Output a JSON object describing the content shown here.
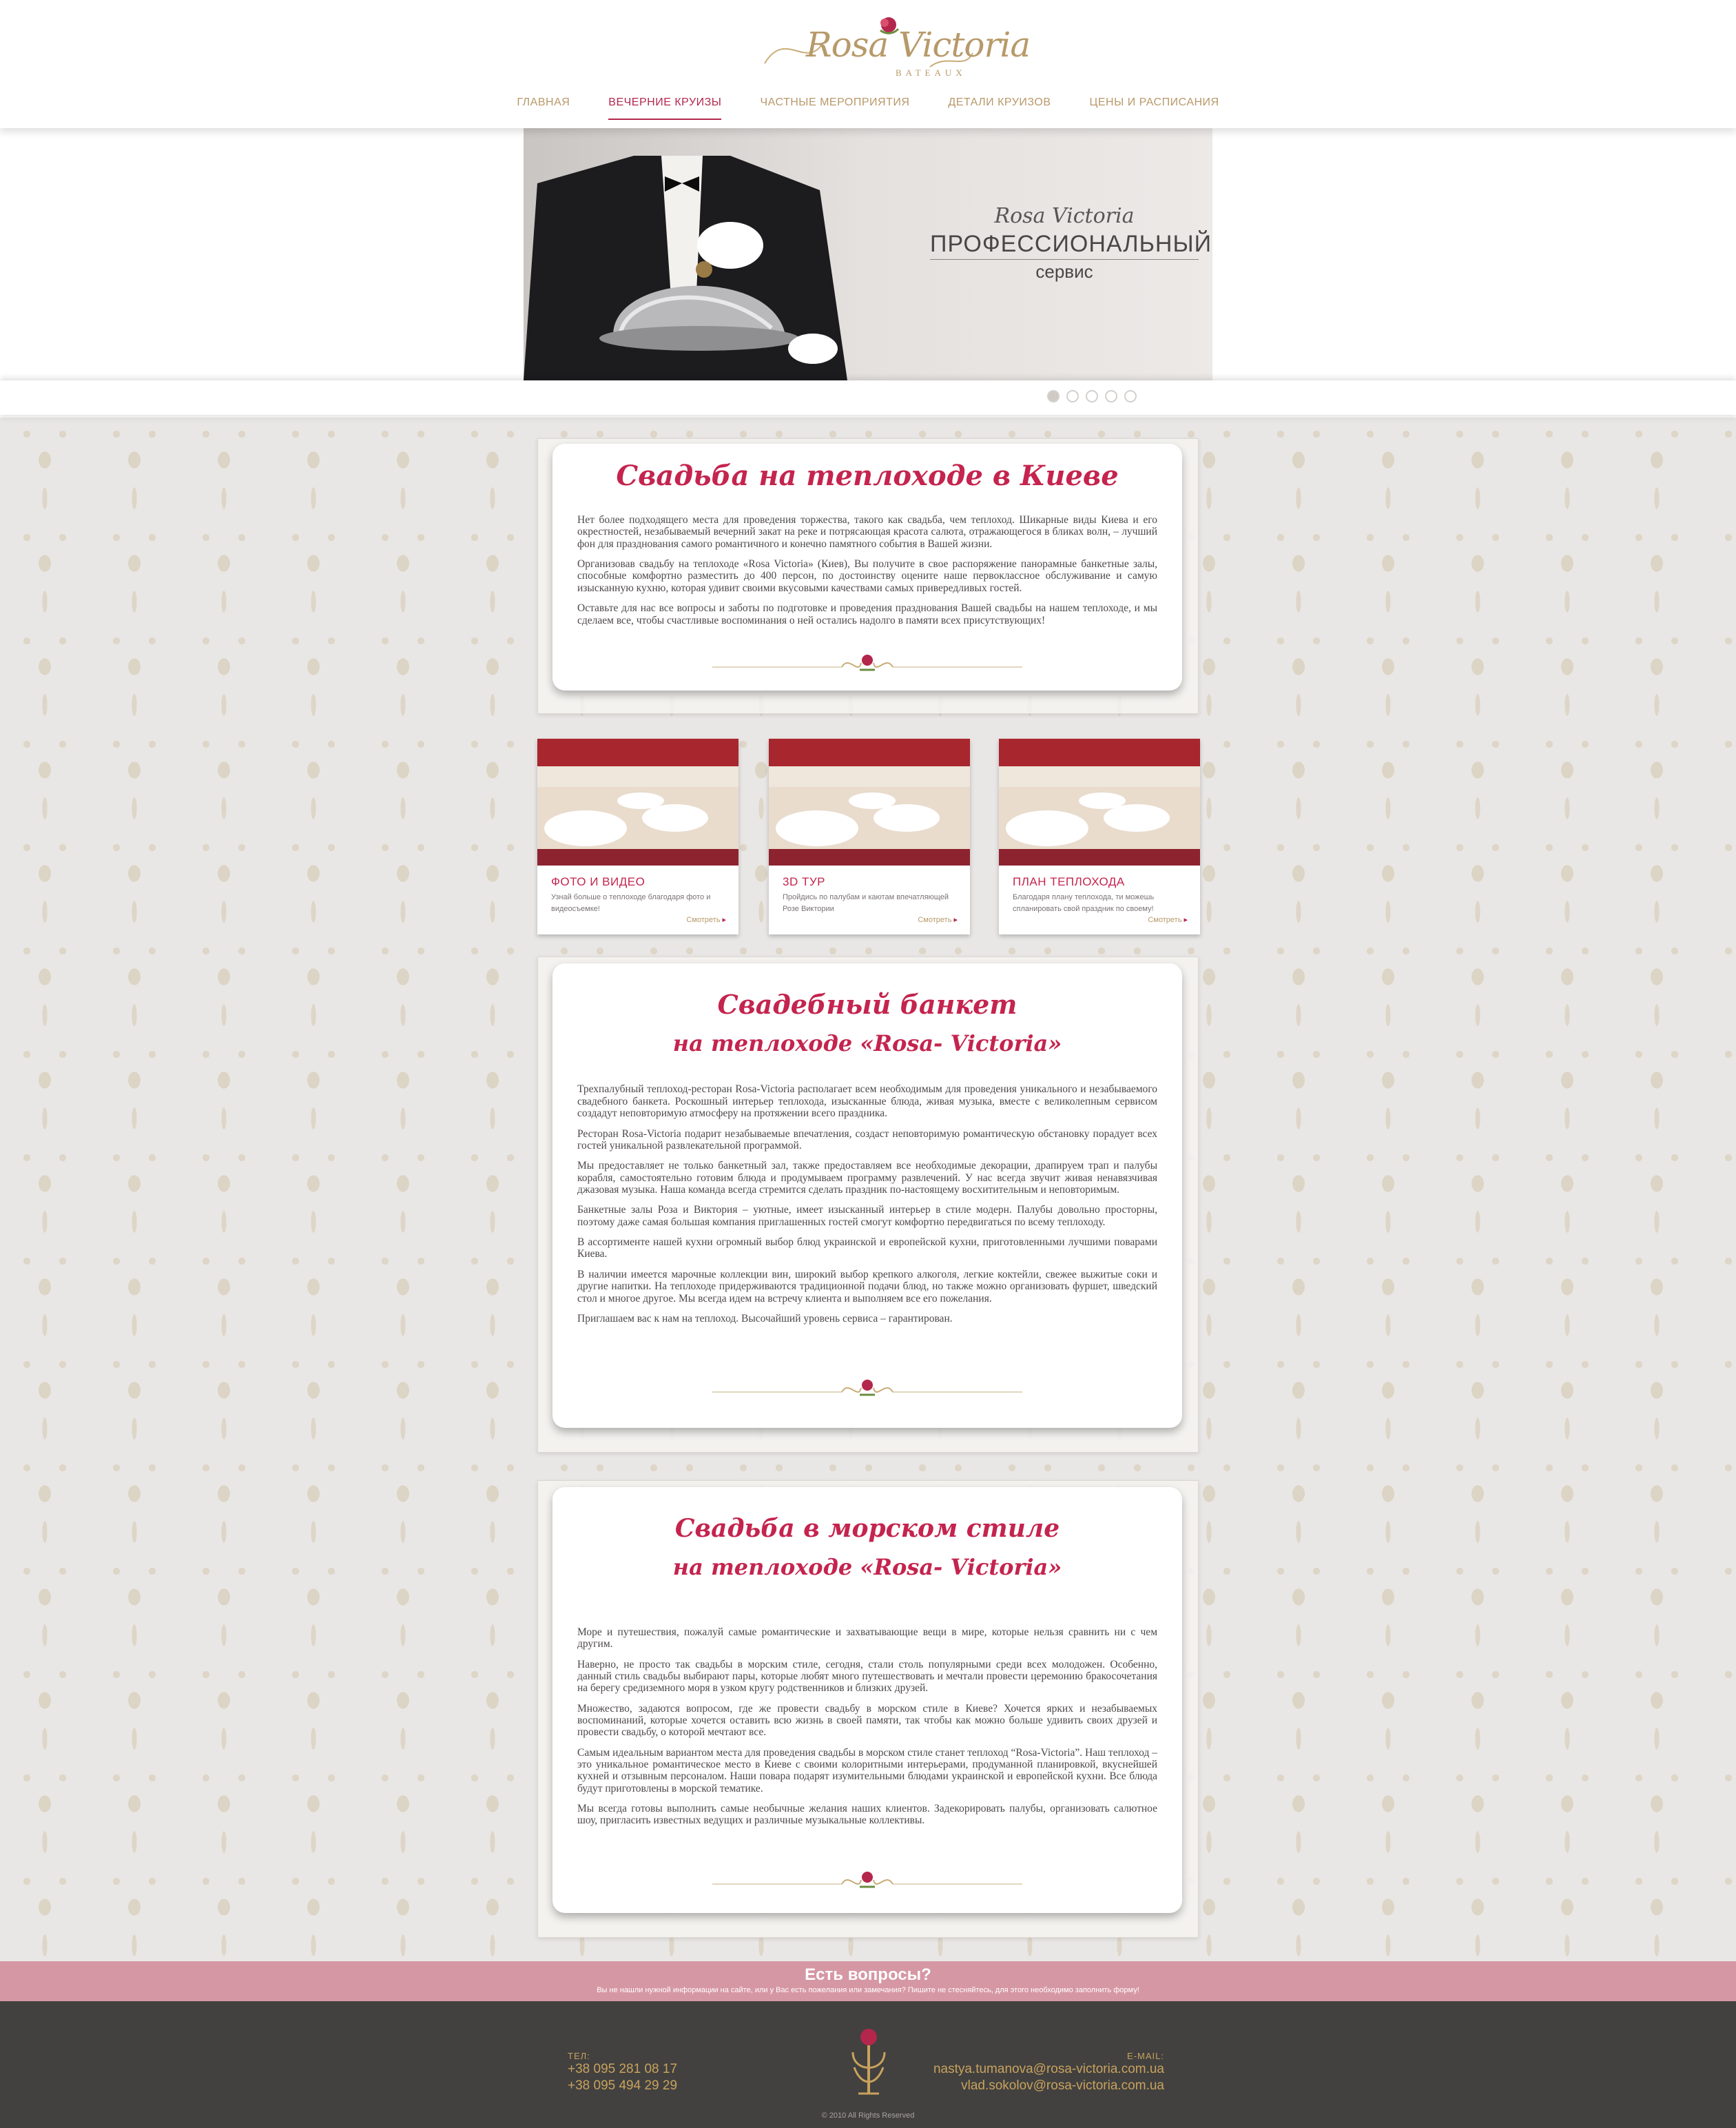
{
  "brand": {
    "logo_text": "Rosa Victoria",
    "logo_sub": "BATEAUX"
  },
  "nav": {
    "items": [
      {
        "label": "ГЛАВНАЯ",
        "active": false
      },
      {
        "label": "ВЕЧЕРНИЕ КРУИЗЫ",
        "active": true
      },
      {
        "label": "ЧАСТНЫЕ МЕРОПРИЯТИЯ",
        "active": false
      },
      {
        "label": "ДЕТАЛИ КРУИЗОВ",
        "active": false
      },
      {
        "label": "ЦЕНЫ И РАСПИСАНИЯ",
        "active": false
      }
    ]
  },
  "hero": {
    "brand": "Rosa Victoria",
    "title": "ПРОФЕССИОНАЛЬНЫЙ",
    "subtitle": "сервис",
    "slide_count": 5,
    "active_slide": 1
  },
  "section1": {
    "title": "Свадьба на теплоходе в Киеве",
    "paragraphs": [
      "Нет более подходящего места для проведения торжества, такого как свадьба, чем теплоход. Шикарные виды Киева и его окрестностей, незабываемый вечерний закат на реке и потрясающая красота салюта, отражающегося в бликах волн, – лучший фон для празднования самого романтичного и конечно памятного события в Вашей жизни.",
      "Организовав свадьбу на теплоходе «Rosa Victoria» (Киев), Вы получите в свое распоряжение панорамные банкетные залы, способные комфортно разместить до 400 персон, по достоинству оцените наше первоклассное обслуживание и самую изысканную кухню, которая удивит своими вкусовыми качествами самых привередливых гостей.",
      "Оставьте для нас все вопросы и заботы по подготовке и проведения празднования Вашей свадьбы на нашем теплоходе, и мы сделаем все, чтобы счастливые воспоминания о ней остались надолго в памяти всех присутствующих!"
    ]
  },
  "tiles": [
    {
      "title": "ФОТО И ВИДЕО",
      "text": "Узнай больше о теплоходе благодаря фото и видеосъемке!",
      "link": "Смотреть"
    },
    {
      "title": "3D ТУР",
      "text": "Пройдись по палубам и каютам впечатляющей Розе Виктории",
      "link": "Смотреть"
    },
    {
      "title": "ПЛАН ТЕПЛОХОДА",
      "text": "Благодаря плану теплохода, ти можешь спланировать свой праздник по своему!",
      "link": "Смотреть"
    }
  ],
  "section2": {
    "title_line1": "Свадебный банкет",
    "title_line2": "на теплоходе «Rosa- Victoria»",
    "paragraphs": [
      "Трехпалубный теплоход-ресторан Rosa-Victoria располагает всем необходимым для проведения уникального и незабываемого свадебного банкета. Роскошный интерьер теплохода, изысканные блюда, живая музыка, вместе с великолепным сервисом создадут неповторимую атмосферу на протяжении всего праздника.",
      "Ресторан Rosa-Victoria подарит незабываемые впечатления, создаст неповторимую романтическую обстановку порадует всех гостей уникальной развлекательной программой.",
      "Мы предоставляет не только банкетный зал, также предоставляем все необходимые декорации, драпируем трап и палубы корабля, самостоятельно готовим блюда и продумываем программу развлечений. У нас всегда звучит живая ненавязчивая джазовая музыка. Наша команда всегда стремится сделать праздник по-настоящему восхитительным и неповторимым.",
      "Банкетные залы Роза и Виктория – уютные, имеет изысканный интерьер в стиле модерн. Палубы довольно просторны, поэтому даже самая большая компания приглашенных гостей смогут комфортно передвигаться по всему теплоходу.",
      "В ассортименте нашей кухни огромный выбор блюд украинской и европейской кухни, приготовленными лучшими поварами Киева.",
      "В наличии имеется марочные коллекции вин, широкий выбор крепкого алкоголя, легкие коктейли, свежее выжитые соки и другие напитки. На теплоходе придерживаются традиционной подачи блюд, но также можно организовать фуршет, шведский стол и многое другое. Мы всегда идем на встречу клиента и выполняем все его пожелания.",
      "Приглашаем вас к нам на теплоход. Высочайший уровень сервиса – гарантирован."
    ]
  },
  "section3": {
    "title_line1": "Свадьба в морском стиле",
    "title_line2": "на теплоходе «Rosa- Victoria»",
    "paragraphs": [
      "Море и путешествия, пожалуй самые романтические и захватывающие вещи в мире, которые нельзя сравнить ни с чем другим.",
      "Наверно, не просто так свадьбы в морским стиле, сегодня, стали столь популярными среди всех молодожен. Особенно, данный стиль свадьбы выбирают пары, которые любят много путешествовать и мечтали провести церемонию бракосочетания на берегу средиземного моря в узком кругу родственников и близких друзей.",
      "Множество, задаются вопросом, где же провести свадьбу в морском стиле в Киеве? Хочется ярких и незабываемых воспоминаний, которые хочется оставить всю жизнь в своей памяти, так чтобы как можно больше удивить своих друзей и провести свадьбу, о которой мечтают все.",
      "Самым идеальным вариантом места для проведения свадьбы в морском стиле станет теплоход “Rosa-Victoria”. Наш теплоход – это уникальное романтическое место в Киеве с своими колоритными интерьерами, продуманной планировкой, вкуснейшей кухней и отзывным персоналом. Наши повара подарят изумительными блюдами украинской и европейской кухни. Все блюда будут приготовлены в морской тематике.",
      "Мы всегда готовы выполнить самые необычные желания наших клиентов. Задекорировать палубы, организовать салютное шоу, пригласить известных ведущих и различные музыкальные коллективы."
    ]
  },
  "questions": {
    "title": "Есть вопросы?",
    "text": "Вы не нашли нужной информации на сайте, или у Вас есть пожелания или замечания? Пишите не стесняйтесь, для этого необходимо заполнить форму!"
  },
  "footer": {
    "phone_label": "ТЕЛ:",
    "phones": [
      "+38 095 281 08 17",
      "+38 095 494 29 29"
    ],
    "email_label": "E-MAIL:",
    "emails": [
      "nastya.tumanova@rosa-victoria.com.ua",
      "vlad.sokolov@rosa-victoria.com.ua"
    ],
    "copyright": "© 2010 All Rights Reserved"
  },
  "colors": {
    "accent": "#c4244e",
    "gold": "#b89869",
    "questions_bar": "#d697a4",
    "footer_bg": "#424140"
  }
}
